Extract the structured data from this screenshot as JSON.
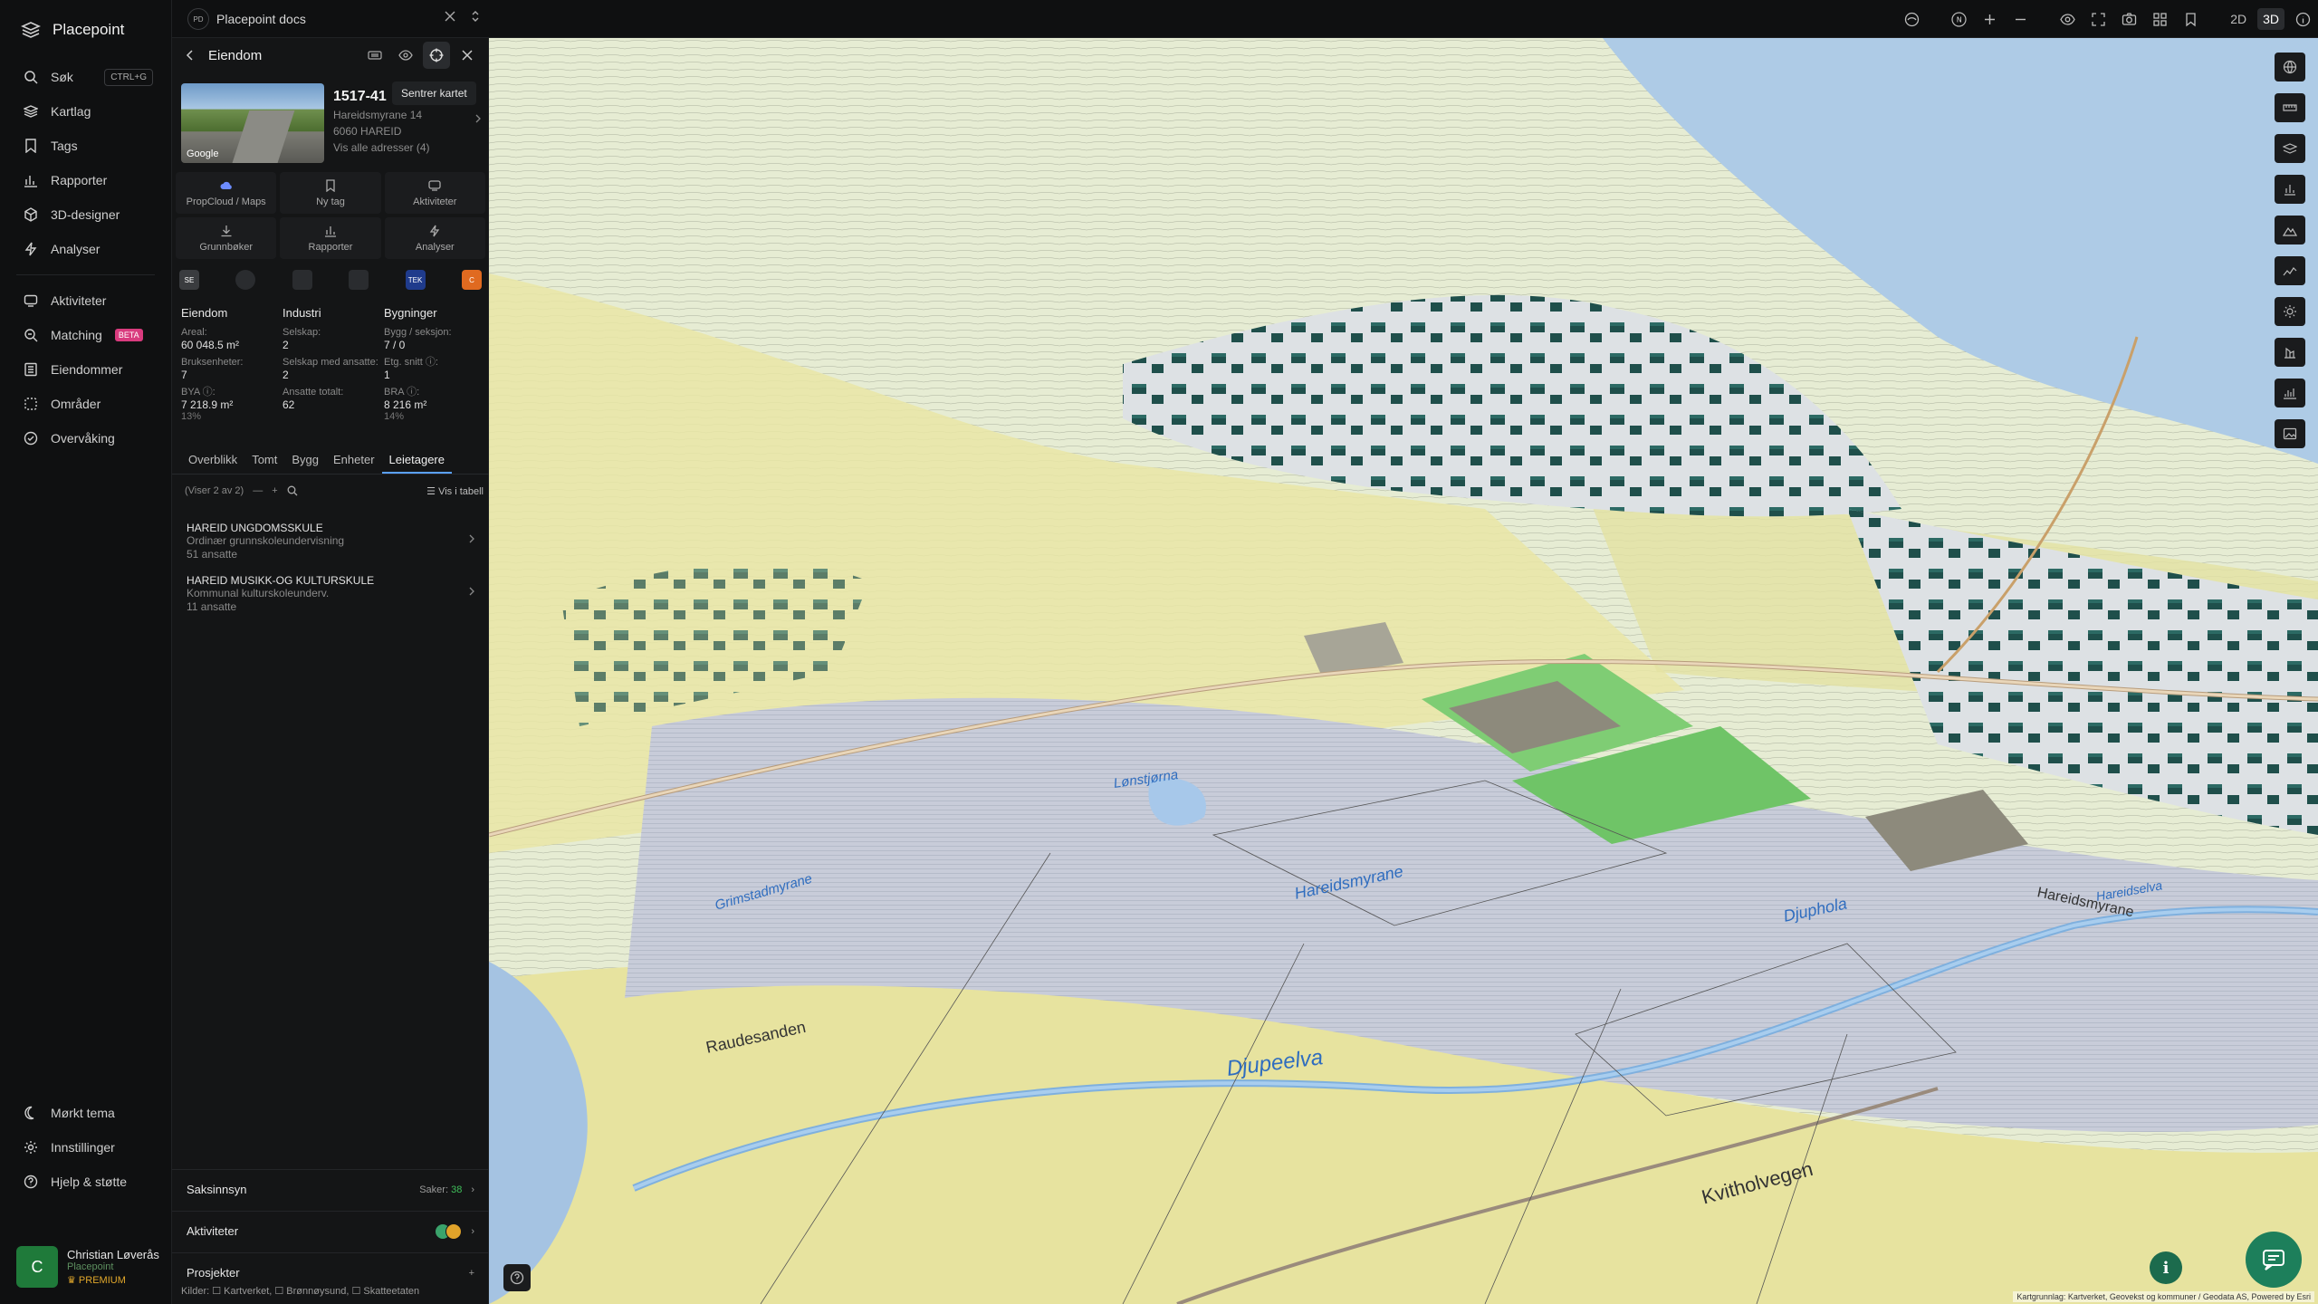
{
  "app": {
    "name": "Placepoint"
  },
  "nav": {
    "items": [
      {
        "label": "Søk",
        "shortcut": "CTRL+G",
        "icon": "search-icon"
      },
      {
        "label": "Kartlag",
        "icon": "layers-icon"
      },
      {
        "label": "Tags",
        "icon": "bookmark-icon"
      },
      {
        "label": "Rapporter",
        "icon": "chart-icon"
      },
      {
        "label": "3D-designer",
        "icon": "cube-icon"
      },
      {
        "label": "Analyser",
        "icon": "bolt-icon"
      }
    ],
    "items2": [
      {
        "label": "Aktiviteter",
        "icon": "activity-icon"
      },
      {
        "label": "Matching",
        "badge": "BETA",
        "icon": "match-icon"
      },
      {
        "label": "Eiendommer",
        "icon": "building-icon"
      },
      {
        "label": "Områder",
        "icon": "area-icon"
      },
      {
        "label": "Overvåking",
        "icon": "monitor-icon"
      }
    ],
    "bottom": [
      {
        "label": "Mørkt tema",
        "icon": "moon-icon"
      },
      {
        "label": "Innstillinger",
        "icon": "gear-icon"
      },
      {
        "label": "Hjelp & støtte",
        "icon": "help-icon"
      }
    ],
    "user": {
      "initial": "C",
      "name": "Christian Løverås",
      "org": "Placepoint",
      "plan": "PREMIUM"
    }
  },
  "topbar": {
    "workspace_badge": "PD",
    "workspace_title": "Placepoint docs",
    "mode_2d": "2D",
    "mode_3d": "3D",
    "compass": "N"
  },
  "panel": {
    "title": "Eiendom",
    "tooltip": "Sentrer kartet",
    "photo_logo": "Google",
    "property": {
      "id": "1517-41",
      "address": "Hareidsmyrane 14",
      "postal": "6060 HAREID",
      "all_addresses": "Vis alle adresser (4)"
    },
    "actions": [
      {
        "label": "PropCloud / Maps",
        "icon": "cloud-icon"
      },
      {
        "label": "Ny tag",
        "icon": "tag-icon"
      },
      {
        "label": "Aktiviteter",
        "icon": "chat-icon"
      },
      {
        "label": "Grunnbøker",
        "icon": "download-icon"
      },
      {
        "label": "Rapporter",
        "icon": "report-icon"
      },
      {
        "label": "Analyser",
        "icon": "analyze-icon"
      }
    ],
    "sources": [
      "SE",
      "",
      "",
      "",
      "TEK",
      "C"
    ],
    "stats": {
      "eiendom": {
        "title": "Eiendom",
        "areal_label": "Areal:",
        "areal": "60 048.5 m²",
        "bruks_label": "Bruksenheter:",
        "bruks": "7",
        "bya_label": "BYA ⓘ:",
        "bya": "7 218.9 m²",
        "bya_pct": "13%"
      },
      "industri": {
        "title": "Industri",
        "selskap_label": "Selskap:",
        "selskap": "2",
        "ansatte_label": "Selskap med ansatte:",
        "ansatte": "2",
        "totalt_label": "Ansatte totalt:",
        "totalt": "62"
      },
      "bygninger": {
        "title": "Bygninger",
        "bygg_label": "Bygg / seksjon:",
        "bygg": "7 / 0",
        "etg_label": "Etg. snitt ⓘ:",
        "etg": "1",
        "bra_label": "BRA ⓘ:",
        "bra": "8 216 m²",
        "bra_pct": "14%"
      }
    },
    "tabs": [
      "Overblikk",
      "Tomt",
      "Bygg",
      "Enheter",
      "Leietagere"
    ],
    "active_tab": "Leietagere",
    "filter": {
      "count": "(Viser 2 av 2)",
      "table": "Vis i tabell"
    },
    "tenants": [
      {
        "name": "HAREID UNGDOMSSKULE",
        "desc": "Ordinær grunnskoleundervisning",
        "emp": "51 ansatte"
      },
      {
        "name": "HAREID MUSIKK-OG KULTURSKULE",
        "desc": "Kommunal kulturskoleunderv.",
        "emp": "11 ansatte"
      }
    ],
    "saksinnsyn": {
      "label": "Saksinnsyn",
      "count_label": "Saker:",
      "count": "38"
    },
    "aktiviteter": {
      "label": "Aktiviteter"
    },
    "prosjekter": {
      "label": "Prosjekter",
      "add": "+"
    },
    "kilder": "Kilder: ☐ Kartverket, ☐ Brønnøysund, ☐ Skatteetaten"
  },
  "map": {
    "labels": {
      "djupeelva": "Djupeelva",
      "hareidsmyrane": "Hareidsmyrane",
      "hareidsmyrane2": "Hareidsmyrane",
      "djuphola": "Djuphola",
      "raudesanden": "Raudesanden",
      "lonstjorna": "Lønstjørna",
      "grimstadmyrane": "Grimstadmyrane",
      "kvitholvegen": "Kvitholvegen",
      "hareidselva": "Hareidselva"
    },
    "attribution": "Kartgrunnlag: Kartverket, Geovekst og kommuner / Geodata AS, Powered by Esri"
  },
  "colors": {
    "accent": "#5aa0ff",
    "chat": "#1d7f5b",
    "beta": "#d93b7e",
    "premium": "#e2a82b"
  }
}
